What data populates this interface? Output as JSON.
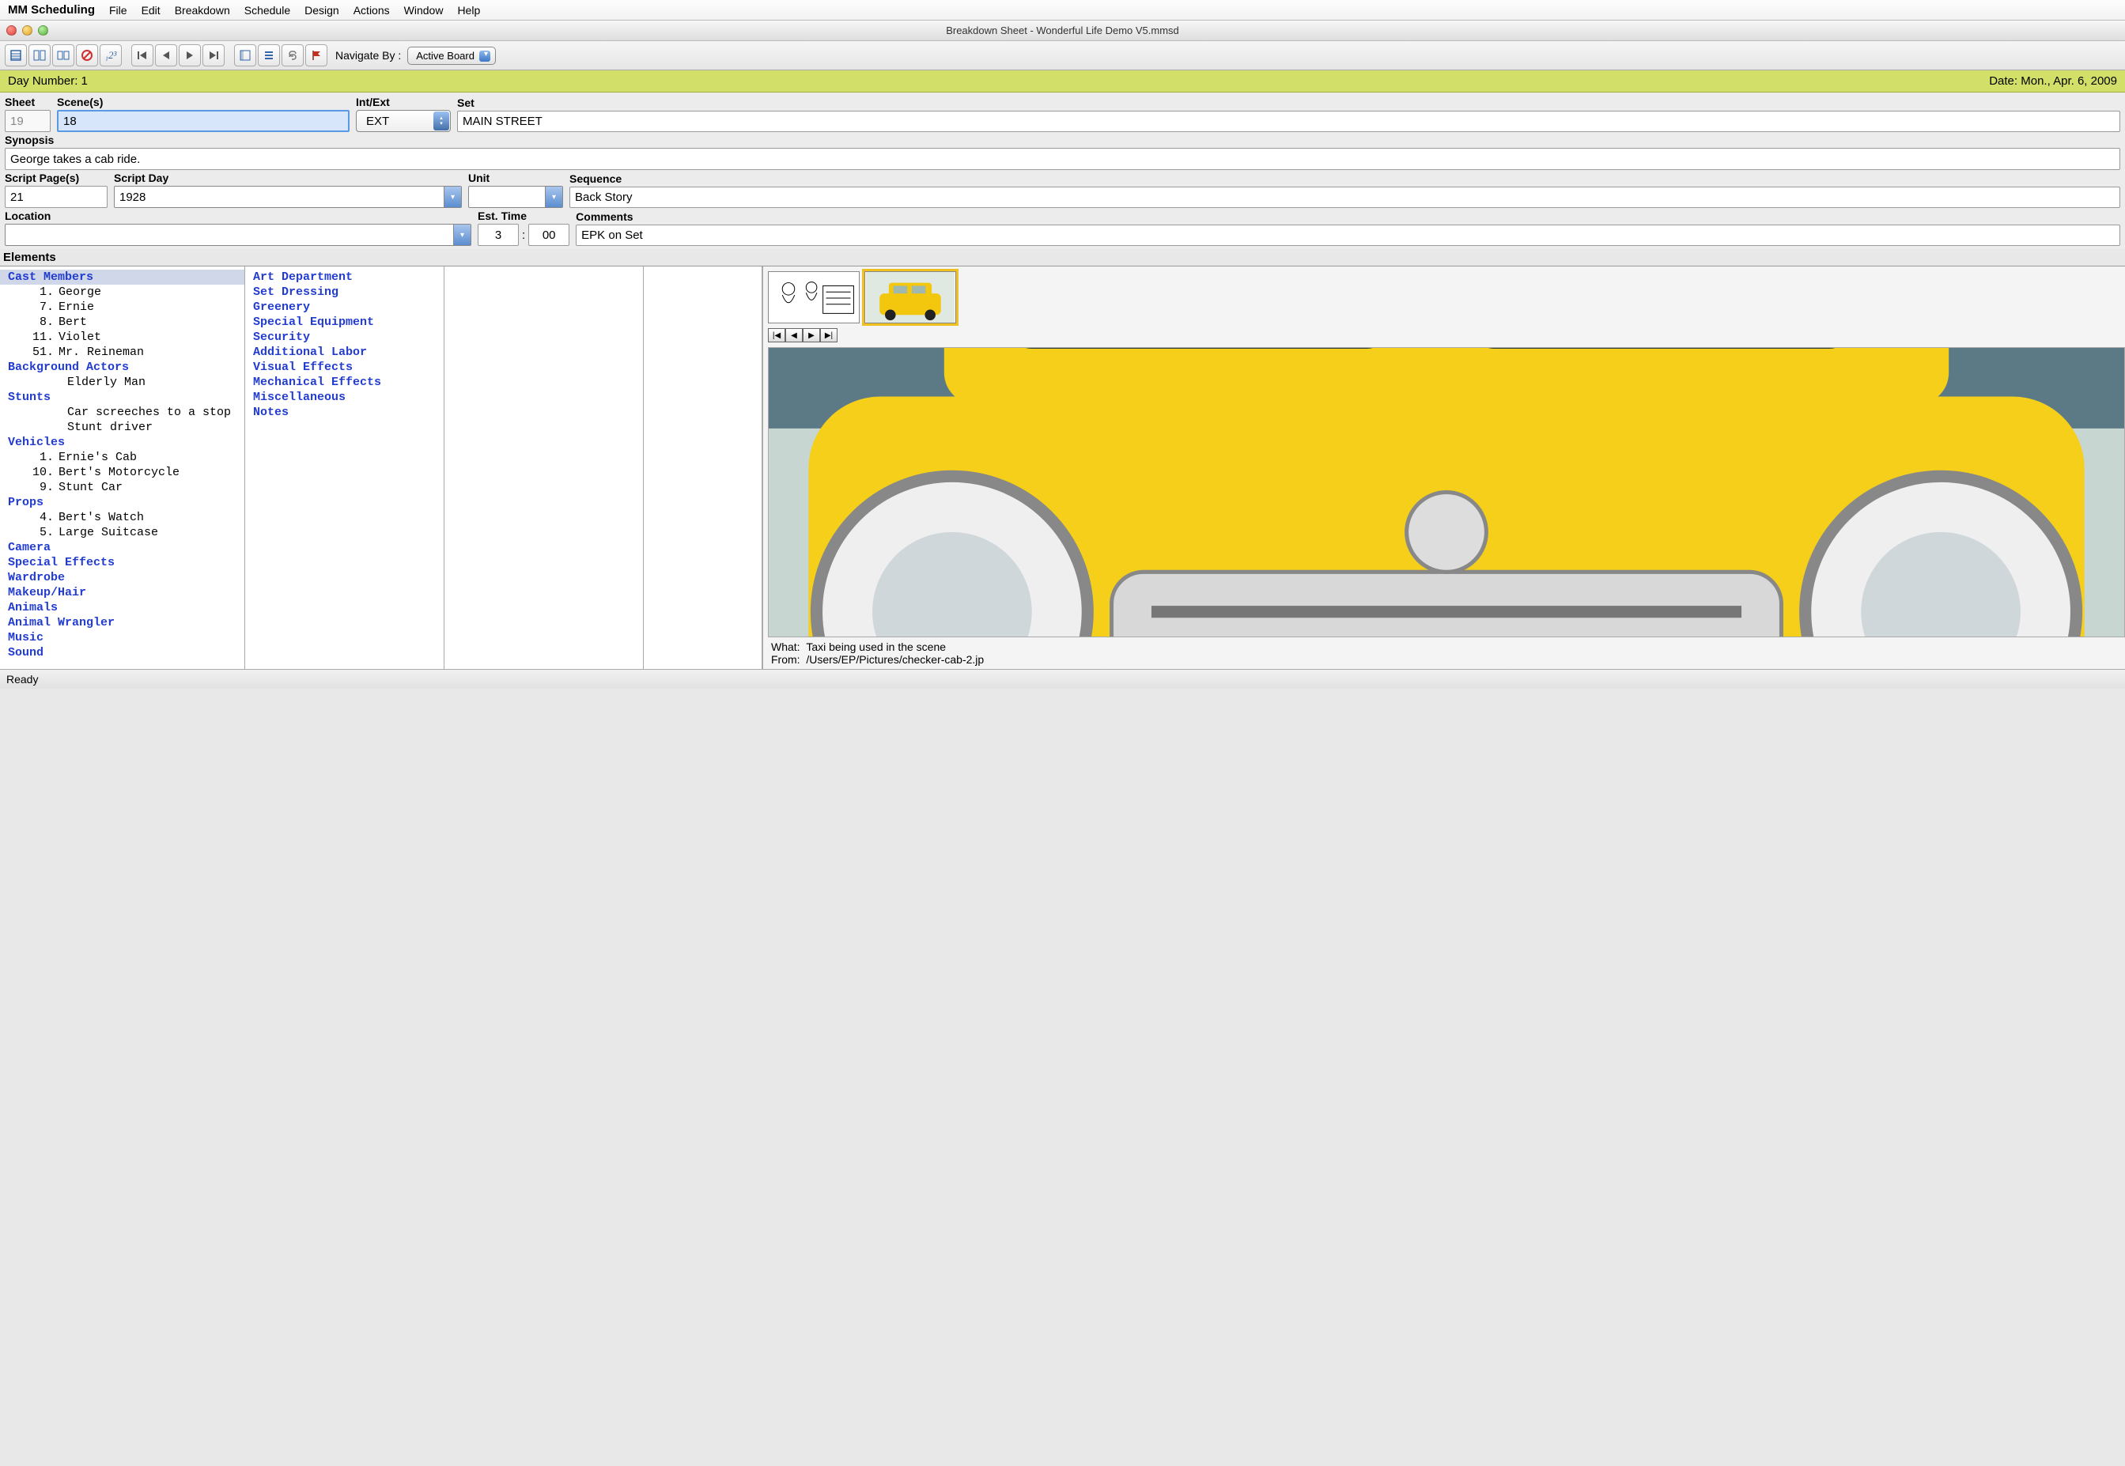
{
  "app_title": "MM Scheduling",
  "menus": [
    "File",
    "Edit",
    "Breakdown",
    "Schedule",
    "Design",
    "Actions",
    "Window",
    "Help"
  ],
  "window_title": "Breakdown Sheet - Wonderful Life Demo V5.mmsd",
  "nav_label": "Navigate By :",
  "nav_value": "Active Board",
  "day_number_label": "Day Number: 1",
  "date_label": "Date: Mon., Apr. 6, 2009",
  "labels": {
    "sheet": "Sheet",
    "scenes": "Scene(s)",
    "intext": "Int/Ext",
    "set": "Set",
    "synopsis": "Synopsis",
    "scriptpages": "Script Page(s)",
    "scriptday": "Script Day",
    "unit": "Unit",
    "sequence": "Sequence",
    "location": "Location",
    "esttime": "Est. Time",
    "comments": "Comments",
    "elements": "Elements"
  },
  "values": {
    "sheet": "19",
    "scenes": "18",
    "intext": "EXT",
    "set": "MAIN STREET",
    "synopsis": "George takes a cab ride.",
    "scriptpages": "21",
    "scriptday": "1928",
    "unit": "",
    "sequence": "Back Story",
    "location": "",
    "eh": "3",
    "em": "00",
    "comments": "EPK on Set"
  },
  "elements_col1": [
    {
      "type": "cat",
      "text": "Cast Members",
      "selected": true
    },
    {
      "type": "item",
      "num": "1.",
      "text": "George"
    },
    {
      "type": "item",
      "num": "7.",
      "text": "Ernie"
    },
    {
      "type": "item",
      "num": "8.",
      "text": "Bert"
    },
    {
      "type": "item",
      "num": "11.",
      "text": "Violet"
    },
    {
      "type": "item",
      "num": "51.",
      "text": "Mr. Reineman"
    },
    {
      "type": "cat",
      "text": "Background Actors"
    },
    {
      "type": "item",
      "num": "",
      "text": "Elderly Man"
    },
    {
      "type": "cat",
      "text": "Stunts"
    },
    {
      "type": "item",
      "num": "",
      "text": "Car screeches to a stop"
    },
    {
      "type": "item",
      "num": "",
      "text": "Stunt driver"
    },
    {
      "type": "cat",
      "text": "Vehicles"
    },
    {
      "type": "item",
      "num": "1.",
      "text": "Ernie's Cab"
    },
    {
      "type": "item",
      "num": "10.",
      "text": "Bert's Motorcycle"
    },
    {
      "type": "item",
      "num": "9.",
      "text": "Stunt Car"
    },
    {
      "type": "cat",
      "text": "Props"
    },
    {
      "type": "item",
      "num": "4.",
      "text": "Bert's Watch"
    },
    {
      "type": "item",
      "num": "5.",
      "text": "Large Suitcase"
    },
    {
      "type": "cat",
      "text": "Camera"
    },
    {
      "type": "cat",
      "text": "Special Effects"
    },
    {
      "type": "cat",
      "text": "Wardrobe"
    },
    {
      "type": "cat",
      "text": "Makeup/Hair"
    },
    {
      "type": "cat",
      "text": "Animals"
    },
    {
      "type": "cat",
      "text": "Animal Wrangler"
    },
    {
      "type": "cat",
      "text": "Music"
    },
    {
      "type": "cat",
      "text": "Sound"
    }
  ],
  "elements_col2": [
    {
      "type": "cat",
      "text": "Art Department"
    },
    {
      "type": "cat",
      "text": "Set Dressing"
    },
    {
      "type": "cat",
      "text": "Greenery"
    },
    {
      "type": "cat",
      "text": "Special Equipment"
    },
    {
      "type": "cat",
      "text": "Security"
    },
    {
      "type": "cat",
      "text": "Additional Labor"
    },
    {
      "type": "cat",
      "text": "Visual Effects"
    },
    {
      "type": "cat",
      "text": "Mechanical Effects"
    },
    {
      "type": "cat",
      "text": "Miscellaneous"
    },
    {
      "type": "cat",
      "text": "Notes"
    }
  ],
  "image_meta": {
    "what_label": "What:",
    "what": "Taxi being used in the scene",
    "from_label": "From:",
    "from": "/Users/EP/Pictures/checker-cab-2.jp"
  },
  "status": "Ready"
}
